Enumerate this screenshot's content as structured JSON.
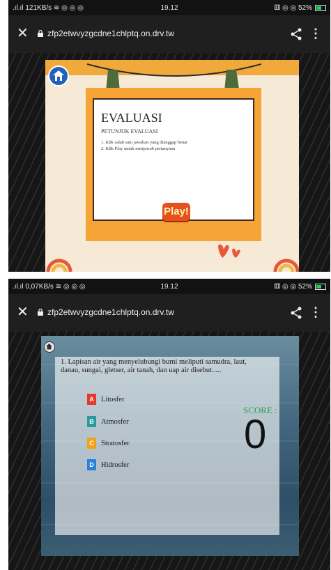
{
  "screen1": {
    "status": {
      "left": ".ıl.ıl 121KB/s ≋ ◎ ◎ ◎",
      "time": "19.12",
      "right": "⚅ ◎ ◎ 52%"
    },
    "url": "zfp2etwvyzgcdne1chlptq.on.drv.tw",
    "game": {
      "title": "EVALUASI",
      "subtitle": "PETUNJUK EVALUASI",
      "instructions": [
        "1. Klik salah satu jawaban yang dianggap benar",
        "2. Klik Play untuk menjawab pertanyaan"
      ],
      "play_label": "Play!"
    }
  },
  "screen2": {
    "status": {
      "left": ".ıl.ıl 0,07KB/s ≋ ◎ ◎ ◎",
      "time": "19.12",
      "right": "⚅ ◎ ◎ 52%"
    },
    "url": "zfp2etwvyzgcdne1chlptq.on.drv.tw",
    "question": "1. Lapisan air yang menyelubungi bumi meliputi samudra, laut, danau, sungai, gletser, air tanah, dan uap air disebut.....",
    "options": [
      {
        "key": "A",
        "label": "Litosfer",
        "color": "#e23a2b"
      },
      {
        "key": "B",
        "label": "Atmosfer",
        "color": "#2a9a9a"
      },
      {
        "key": "C",
        "label": "Stratosfer",
        "color": "#f0a21b"
      },
      {
        "key": "D",
        "label": "Hidrosfer",
        "color": "#2a7fd6"
      }
    ],
    "score_label": "SCORE :",
    "score_value": "0"
  },
  "icons": {
    "close": "close-icon",
    "lock": "lock-icon",
    "share": "share-icon",
    "menu": "more-vert-icon",
    "home": "home-icon"
  }
}
